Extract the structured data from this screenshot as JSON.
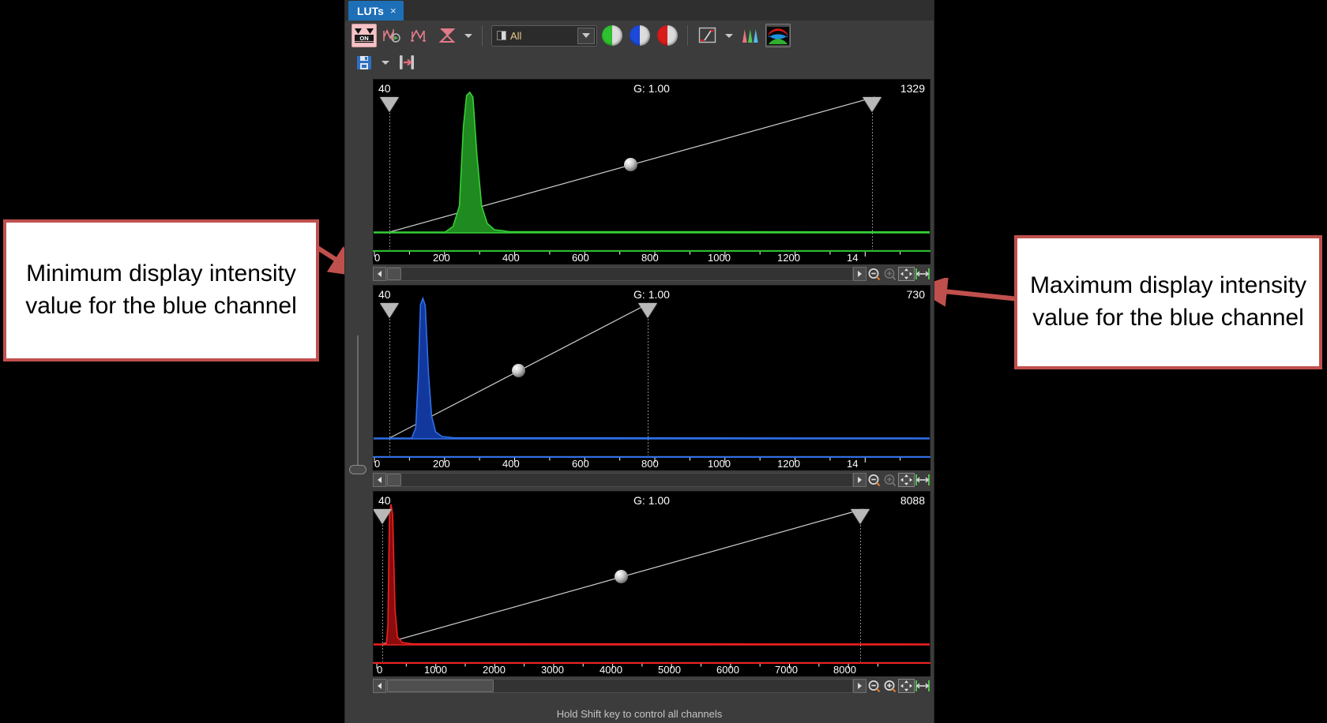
{
  "window": {
    "tab_label": "LUTs",
    "tab_close": "×",
    "status_text": "Hold Shift key to control all channels"
  },
  "toolbar": {
    "row1": [
      {
        "name": "auto-lut-toggle",
        "label": "ON",
        "state": "active"
      },
      {
        "name": "smooth-histogram-icon",
        "label": ""
      },
      {
        "name": "reset-histogram-icon",
        "label": ""
      },
      {
        "name": "invert-lut-icon",
        "label": ""
      },
      {
        "name": "lut-options-caret",
        "label": ""
      }
    ],
    "channel_select": {
      "value": "All",
      "swatch": "grayscale-swatch"
    },
    "channel_buttons": [
      {
        "name": "green-channel-button",
        "color": "#2fc02f"
      },
      {
        "name": "blue-channel-button",
        "color": "#1c49d8"
      },
      {
        "name": "red-channel-button",
        "color": "#d81c1c"
      }
    ],
    "curve_button": {
      "name": "lut-curve-icon"
    },
    "curve_caret": {
      "name": "lut-curve-caret"
    },
    "histogram_button": {
      "name": "rgb-histogram-icon"
    },
    "composite_button": {
      "name": "composite-lut-icon",
      "state": "framed"
    },
    "row2": [
      {
        "name": "save-lut-icon",
        "label": ""
      },
      {
        "name": "save-lut-caret",
        "label": ""
      },
      {
        "name": "apply-lut-icon",
        "label": ""
      }
    ]
  },
  "channels": [
    {
      "id": "green",
      "name": "green-channel-panel",
      "color": "#28b428",
      "min_label": "40",
      "max_label": "1329",
      "gamma_label": "G: 1.00",
      "min_value": 40,
      "max_value": 1329,
      "gamma": 1.0,
      "axis_ticks": [
        "0",
        "200",
        "400",
        "600",
        "800",
        "1000",
        "1200",
        "14"
      ],
      "axis_max": 1400,
      "peak_center": 210,
      "peak_width": 38,
      "scroll_thumb_pct": 3
    },
    {
      "id": "blue",
      "name": "blue-channel-panel",
      "color": "#1f4fd8",
      "min_label": "40",
      "max_label": "730",
      "gamma_label": "G: 1.00",
      "min_value": 40,
      "max_value": 730,
      "gamma": 1.0,
      "axis_ticks": [
        "0",
        "200",
        "400",
        "600",
        "800",
        "1000",
        "1200",
        "14"
      ],
      "axis_max": 1400,
      "peak_center": 130,
      "peak_width": 28,
      "scroll_thumb_pct": 3
    },
    {
      "id": "red",
      "name": "red-channel-panel",
      "color": "#e01010",
      "min_label": "40",
      "max_label": "8088",
      "gamma_label": "G: 1.00",
      "min_value": 40,
      "max_value": 8088,
      "gamma": 1.0,
      "axis_ticks": [
        "0",
        "1000",
        "2000",
        "3000",
        "4000",
        "5000",
        "6000",
        "7000",
        "8000"
      ],
      "axis_max": 8600,
      "peak_center": 300,
      "peak_width": 90,
      "scroll_thumb_pct": 23
    }
  ],
  "controlbar": {
    "left_arrow": "◀",
    "right_arrow": "▶",
    "zoom_out": "zoom-out-icon",
    "zoom_in": "zoom-in-icon",
    "fit_all": "fit-all-icon",
    "fit_width": "fit-width-icon"
  },
  "callouts": [
    {
      "name": "callout-minimum",
      "text": "Minimum display intensity value for the blue channel",
      "border_color": "#c0504d"
    },
    {
      "name": "callout-maximum",
      "text": "Maximum display intensity value for the blue channel",
      "border_color": "#c0504d"
    }
  ]
}
